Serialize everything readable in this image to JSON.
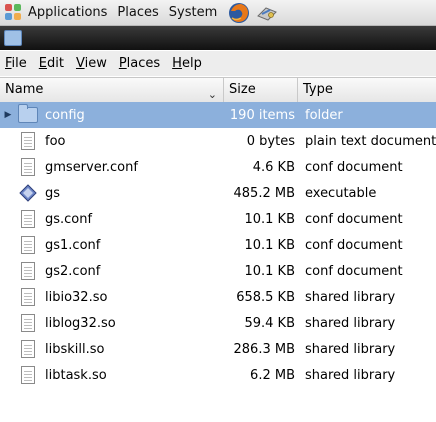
{
  "panel": {
    "items": [
      {
        "label": "Applications"
      },
      {
        "label": "Places"
      },
      {
        "label": "System"
      }
    ]
  },
  "menubar": {
    "items": [
      {
        "accel": "F",
        "rest": "ile"
      },
      {
        "accel": "E",
        "rest": "dit"
      },
      {
        "accel": "V",
        "rest": "iew"
      },
      {
        "accel": "P",
        "rest": "laces"
      },
      {
        "accel": "H",
        "rest": "elp"
      }
    ]
  },
  "columns": {
    "name": "Name",
    "size": "Size",
    "type": "Type"
  },
  "rows": [
    {
      "name": "config",
      "size": "190 items",
      "type": "folder",
      "icon": "folder-icon",
      "selected": true,
      "expandable": true
    },
    {
      "name": "foo",
      "size": "0 bytes",
      "type": "plain text document",
      "icon": "text-file-icon"
    },
    {
      "name": "gmserver.conf",
      "size": "4.6 KB",
      "type": "conf document",
      "icon": "text-file-icon"
    },
    {
      "name": "gs",
      "size": "485.2 MB",
      "type": "executable",
      "icon": "executable-icon"
    },
    {
      "name": "gs.conf",
      "size": "10.1 KB",
      "type": "conf document",
      "icon": "text-file-icon"
    },
    {
      "name": "gs1.conf",
      "size": "10.1 KB",
      "type": "conf document",
      "icon": "text-file-icon"
    },
    {
      "name": "gs2.conf",
      "size": "10.1 KB",
      "type": "conf document",
      "icon": "text-file-icon"
    },
    {
      "name": "libio32.so",
      "size": "658.5 KB",
      "type": "shared library",
      "icon": "text-file-icon"
    },
    {
      "name": "liblog32.so",
      "size": "59.4 KB",
      "type": "shared library",
      "icon": "text-file-icon"
    },
    {
      "name": "libskill.so",
      "size": "286.3 MB",
      "type": "shared library",
      "icon": "text-file-icon"
    },
    {
      "name": "libtask.so",
      "size": "6.2 MB",
      "type": "shared library",
      "icon": "text-file-icon"
    }
  ],
  "colors": {
    "selection": "#8cb0dc",
    "titlebar": "#1a1a1a",
    "folder": "#b8d0ee"
  }
}
